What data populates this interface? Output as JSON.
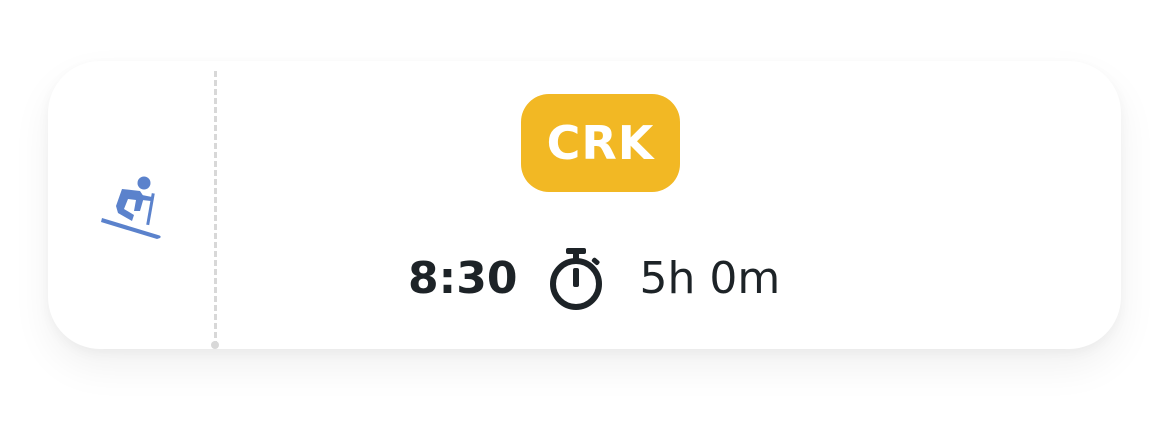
{
  "trip": {
    "icon": "skiing-icon",
    "code": "CRK",
    "badge_color": "#f2b824",
    "icon_color": "#5b82cc",
    "departure_time": "8:30",
    "duration_icon": "stopwatch-icon",
    "duration": "5h 0m"
  }
}
